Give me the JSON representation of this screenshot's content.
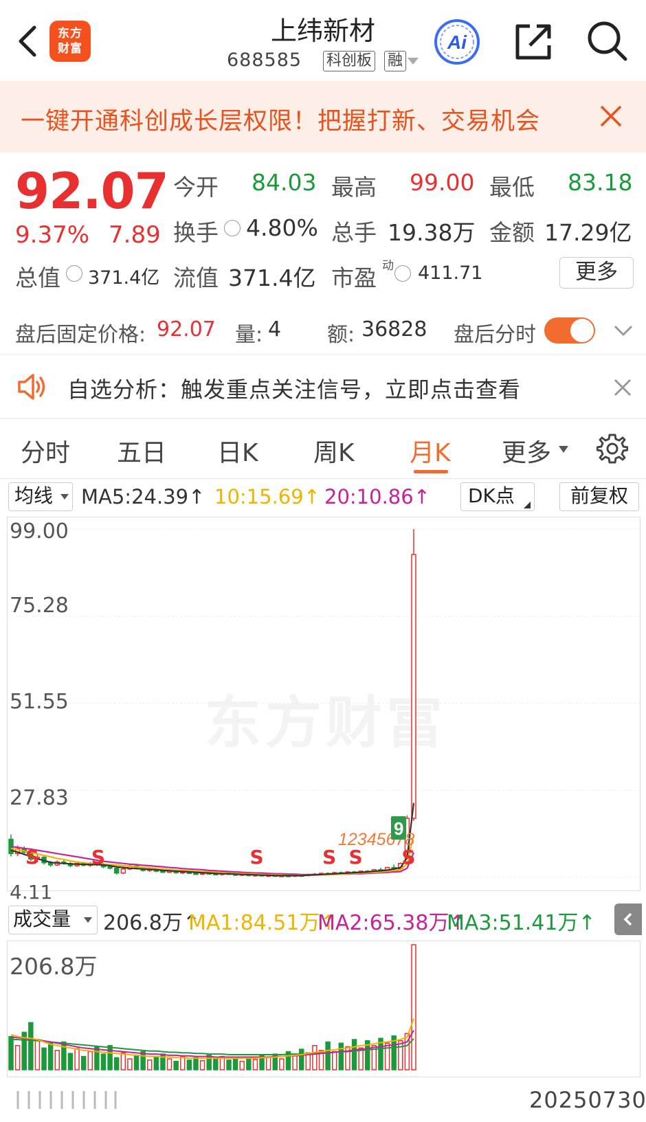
{
  "header": {
    "logo": [
      "东方",
      "财富"
    ],
    "title": "上纬新材",
    "code": "688585",
    "tags": [
      "科创板",
      "融"
    ],
    "ai_label": "Ai"
  },
  "banner": {
    "text": "一键开通科创成长层权限！把握打新、交易机会"
  },
  "quote": {
    "price": "92.07",
    "change_pct": "9.37%",
    "change": "7.89",
    "open_label": "今开",
    "open": "84.03",
    "high_label": "最高",
    "high": "99.00",
    "low_label": "最低",
    "low": "83.18",
    "turnover_label": "换手",
    "turnover": "4.80%",
    "volume_label": "总手",
    "volume": "19.38万",
    "amount_label": "金额",
    "amount": "17.29亿",
    "mktcap_label": "总值",
    "mktcap": "371.4亿",
    "float_label": "流值",
    "float": "371.4亿",
    "pe_label": "市盈",
    "pe_sup": "动",
    "pe": "411.71",
    "more_label": "更多"
  },
  "after_hours": {
    "price_label": "盘后固定价格:",
    "price": "92.07",
    "qty_label": "量:",
    "qty": "4",
    "amt_label": "额:",
    "amt": "36828",
    "toggle_label": "盘后分时"
  },
  "notice": {
    "text": "自选分析：触发重点关注信号，立即点击查看"
  },
  "tabs": [
    {
      "label": "分时"
    },
    {
      "label": "五日"
    },
    {
      "label": "日K"
    },
    {
      "label": "周K"
    },
    {
      "label": "月K"
    },
    {
      "label": "更多"
    }
  ],
  "ma_row": {
    "type_label": "均线",
    "ma5": "MA5:24.39↑",
    "ma10": "10:15.69↑",
    "ma20": "20:10.86↑",
    "dk_label": "DK点",
    "adjust_label": "前复权"
  },
  "price_axis": [
    "99.00",
    "75.28",
    "51.55",
    "27.83",
    "4.11"
  ],
  "watermark": "东方财富",
  "signals": {
    "sell": "S",
    "count_seq": "12345678",
    "count_last": "9"
  },
  "volume": {
    "type_label": "成交量",
    "current": "206.8万↑",
    "ma1": "MA1:84.51万↑",
    "ma2": "MA2:65.38万↑",
    "ma3": "MA3:51.41万↑",
    "axis_top": "206.8万"
  },
  "date": "20250730",
  "colors": {
    "up": "#e93030",
    "down": "#1a9a3a",
    "accent": "#f26c2f",
    "ma5": "#333333",
    "ma10": "#f0b400",
    "ma20": "#c8219a"
  },
  "chart_data": {
    "type": "candlestick",
    "ylim": [
      4.11,
      99.0
    ],
    "candles": [
      {
        "o": 14.5,
        "h": 15.8,
        "l": 9.8,
        "c": 10.6
      },
      {
        "o": 10.6,
        "h": 12.8,
        "l": 9.9,
        "c": 11.9
      },
      {
        "o": 11.9,
        "h": 12.6,
        "l": 10.4,
        "c": 11.0
      },
      {
        "o": 11.0,
        "h": 11.6,
        "l": 8.6,
        "c": 9.1
      },
      {
        "o": 9.1,
        "h": 10.4,
        "l": 8.2,
        "c": 9.6
      },
      {
        "o": 9.6,
        "h": 9.9,
        "l": 7.6,
        "c": 8.1
      },
      {
        "o": 8.1,
        "h": 8.6,
        "l": 7.0,
        "c": 7.5
      },
      {
        "o": 7.5,
        "h": 8.7,
        "l": 7.2,
        "c": 8.3
      },
      {
        "o": 8.3,
        "h": 8.9,
        "l": 7.6,
        "c": 7.9
      },
      {
        "o": 7.9,
        "h": 8.3,
        "l": 6.9,
        "c": 7.3
      },
      {
        "o": 7.3,
        "h": 8.2,
        "l": 7.0,
        "c": 7.9
      },
      {
        "o": 7.9,
        "h": 8.4,
        "l": 7.1,
        "c": 7.4
      },
      {
        "o": 7.4,
        "h": 8.3,
        "l": 7.0,
        "c": 8.0
      },
      {
        "o": 8.0,
        "h": 8.5,
        "l": 7.2,
        "c": 7.6
      },
      {
        "o": 7.6,
        "h": 8.0,
        "l": 6.6,
        "c": 7.0
      },
      {
        "o": 7.0,
        "h": 7.6,
        "l": 6.3,
        "c": 6.6
      },
      {
        "o": 6.6,
        "h": 7.0,
        "l": 4.9,
        "c": 5.3
      },
      {
        "o": 5.3,
        "h": 6.8,
        "l": 5.0,
        "c": 6.4
      },
      {
        "o": 6.4,
        "h": 7.6,
        "l": 6.1,
        "c": 7.2
      },
      {
        "o": 7.2,
        "h": 7.5,
        "l": 6.3,
        "c": 6.6
      },
      {
        "o": 6.6,
        "h": 6.9,
        "l": 5.7,
        "c": 6.0
      },
      {
        "o": 6.0,
        "h": 6.8,
        "l": 5.6,
        "c": 6.4
      },
      {
        "o": 6.4,
        "h": 6.7,
        "l": 5.5,
        "c": 5.8
      },
      {
        "o": 5.8,
        "h": 6.3,
        "l": 5.3,
        "c": 5.5
      },
      {
        "o": 5.5,
        "h": 6.2,
        "l": 5.3,
        "c": 5.9
      },
      {
        "o": 5.9,
        "h": 6.2,
        "l": 5.1,
        "c": 5.4
      },
      {
        "o": 5.4,
        "h": 5.9,
        "l": 5.0,
        "c": 5.6
      },
      {
        "o": 5.6,
        "h": 5.9,
        "l": 5.0,
        "c": 5.2
      },
      {
        "o": 5.2,
        "h": 5.6,
        "l": 4.8,
        "c": 5.0
      },
      {
        "o": 5.0,
        "h": 5.5,
        "l": 4.7,
        "c": 5.3
      },
      {
        "o": 5.3,
        "h": 5.6,
        "l": 4.9,
        "c": 5.1
      },
      {
        "o": 5.1,
        "h": 5.4,
        "l": 4.7,
        "c": 4.9
      },
      {
        "o": 4.9,
        "h": 5.4,
        "l": 4.6,
        "c": 5.2
      },
      {
        "o": 5.2,
        "h": 5.5,
        "l": 4.8,
        "c": 5.0
      },
      {
        "o": 5.0,
        "h": 5.4,
        "l": 4.5,
        "c": 4.7
      },
      {
        "o": 4.7,
        "h": 5.2,
        "l": 4.5,
        "c": 5.0
      },
      {
        "o": 5.0,
        "h": 5.2,
        "l": 4.4,
        "c": 4.6
      },
      {
        "o": 4.6,
        "h": 5.0,
        "l": 4.3,
        "c": 4.8
      },
      {
        "o": 4.8,
        "h": 5.1,
        "l": 4.4,
        "c": 4.5
      },
      {
        "o": 4.5,
        "h": 4.9,
        "l": 4.2,
        "c": 4.7
      },
      {
        "o": 4.7,
        "h": 4.9,
        "l": 4.3,
        "c": 4.4
      },
      {
        "o": 4.4,
        "h": 4.8,
        "l": 4.2,
        "c": 4.6
      },
      {
        "o": 4.6,
        "h": 4.9,
        "l": 4.3,
        "c": 4.5
      },
      {
        "o": 4.5,
        "h": 4.8,
        "l": 4.2,
        "c": 4.7
      },
      {
        "o": 4.7,
        "h": 5.0,
        "l": 4.4,
        "c": 4.6
      },
      {
        "o": 4.6,
        "h": 5.1,
        "l": 4.4,
        "c": 4.9
      },
      {
        "o": 4.9,
        "h": 5.3,
        "l": 4.6,
        "c": 5.0
      },
      {
        "o": 5.0,
        "h": 5.4,
        "l": 4.7,
        "c": 5.2
      },
      {
        "o": 5.2,
        "h": 5.5,
        "l": 4.8,
        "c": 4.9
      },
      {
        "o": 4.9,
        "h": 5.6,
        "l": 4.8,
        "c": 5.4
      },
      {
        "o": 5.4,
        "h": 5.7,
        "l": 5.0,
        "c": 5.1
      },
      {
        "o": 5.1,
        "h": 5.8,
        "l": 5.0,
        "c": 5.6
      },
      {
        "o": 5.6,
        "h": 5.9,
        "l": 5.1,
        "c": 5.3
      },
      {
        "o": 5.3,
        "h": 6.0,
        "l": 5.2,
        "c": 5.8
      },
      {
        "o": 5.8,
        "h": 6.1,
        "l": 5.3,
        "c": 5.5
      },
      {
        "o": 5.5,
        "h": 6.4,
        "l": 5.4,
        "c": 6.2
      },
      {
        "o": 6.2,
        "h": 6.7,
        "l": 5.8,
        "c": 6.0
      },
      {
        "o": 6.0,
        "h": 7.0,
        "l": 5.9,
        "c": 6.8
      },
      {
        "o": 6.8,
        "h": 7.6,
        "l": 6.3,
        "c": 6.5
      },
      {
        "o": 6.5,
        "h": 8.2,
        "l": 6.3,
        "c": 7.9
      },
      {
        "o": 7.9,
        "h": 21.0,
        "l": 7.6,
        "c": 20.2
      },
      {
        "o": 20.2,
        "h": 99.0,
        "l": 19.5,
        "c": 92.07
      }
    ],
    "ma5": [
      11.5,
      11.0,
      10.4,
      9.8,
      9.2,
      8.7,
      8.2,
      8.0,
      7.9,
      7.8,
      7.7,
      7.7,
      7.6,
      7.6,
      7.5,
      7.3,
      7.0,
      6.8,
      6.6,
      6.5,
      6.4,
      6.3,
      6.2,
      6.0,
      5.9,
      5.8,
      5.7,
      5.6,
      5.5,
      5.4,
      5.3,
      5.2,
      5.1,
      5.1,
      5.0,
      4.9,
      4.9,
      4.8,
      4.7,
      4.7,
      4.6,
      4.6,
      4.6,
      4.6,
      4.6,
      4.7,
      4.8,
      4.9,
      5.0,
      5.1,
      5.2,
      5.3,
      5.4,
      5.5,
      5.6,
      5.8,
      5.9,
      6.1,
      6.4,
      6.8,
      9.5,
      24.39
    ],
    "ma10": [
      12.0,
      11.7,
      11.3,
      10.9,
      10.5,
      10.1,
      9.7,
      9.3,
      9.0,
      8.6,
      8.3,
      8.1,
      7.9,
      7.8,
      7.7,
      7.6,
      7.5,
      7.3,
      7.1,
      7.0,
      6.8,
      6.7,
      6.5,
      6.4,
      6.2,
      6.1,
      6.0,
      5.9,
      5.8,
      5.7,
      5.6,
      5.5,
      5.4,
      5.3,
      5.2,
      5.1,
      5.1,
      5.0,
      4.9,
      4.9,
      4.8,
      4.8,
      4.7,
      4.7,
      4.7,
      4.7,
      4.7,
      4.8,
      4.8,
      4.9,
      5.0,
      5.1,
      5.2,
      5.3,
      5.4,
      5.5,
      5.6,
      5.8,
      6.0,
      6.2,
      7.8,
      15.69
    ],
    "ma20": [
      12.5,
      12.3,
      12.0,
      11.8,
      11.5,
      11.2,
      10.9,
      10.6,
      10.3,
      10.0,
      9.7,
      9.4,
      9.1,
      8.8,
      8.5,
      8.3,
      8.1,
      7.9,
      7.7,
      7.6,
      7.4,
      7.3,
      7.1,
      7.0,
      6.8,
      6.7,
      6.5,
      6.4,
      6.3,
      6.2,
      6.0,
      5.9,
      5.8,
      5.7,
      5.6,
      5.5,
      5.4,
      5.3,
      5.3,
      5.2,
      5.1,
      5.1,
      5.0,
      5.0,
      4.9,
      4.9,
      4.9,
      4.9,
      4.9,
      4.9,
      5.0,
      5.0,
      5.1,
      5.1,
      5.2,
      5.3,
      5.4,
      5.5,
      5.6,
      5.7,
      6.6,
      10.86
    ],
    "sell_signal_indices": [
      3,
      13,
      37,
      48,
      52,
      60
    ],
    "volume_ylim": [
      0,
      206.8
    ],
    "volume_values": [
      55,
      40,
      62,
      78,
      50,
      36,
      44,
      32,
      46,
      27,
      35,
      22,
      30,
      38,
      26,
      40,
      20,
      28,
      18,
      24,
      30,
      16,
      22,
      26,
      18,
      14,
      22,
      16,
      20,
      15,
      24,
      18,
      22,
      16,
      21,
      14,
      19,
      17,
      24,
      20,
      26,
      18,
      30,
      24,
      34,
      28,
      40,
      32,
      46,
      30,
      44,
      38,
      50,
      36,
      48,
      40,
      52,
      44,
      56,
      48,
      60,
      206.8
    ],
    "volume_ma1": [
      58,
      55,
      53,
      52,
      50,
      46,
      42,
      40,
      38,
      36,
      34,
      32,
      31,
      30,
      29,
      28,
      27,
      26,
      25,
      24,
      23,
      22,
      22,
      21,
      21,
      20,
      20,
      19,
      19,
      19,
      19,
      19,
      19,
      19,
      19,
      19,
      19,
      19,
      20,
      20,
      21,
      22,
      23,
      24,
      25,
      27,
      29,
      30,
      32,
      33,
      35,
      36,
      38,
      40,
      41,
      43,
      45,
      46,
      48,
      50,
      54,
      84.51
    ],
    "volume_ma2": [
      54,
      53,
      52,
      51,
      50,
      48,
      46,
      44,
      42,
      40,
      38,
      36,
      35,
      34,
      33,
      32,
      31,
      30,
      29,
      28,
      27,
      26,
      26,
      25,
      24,
      24,
      23,
      23,
      22,
      22,
      22,
      21,
      21,
      21,
      21,
      21,
      21,
      21,
      21,
      21,
      22,
      22,
      23,
      23,
      24,
      25,
      26,
      27,
      28,
      29,
      30,
      31,
      33,
      34,
      35,
      37,
      38,
      40,
      41,
      43,
      46,
      65.38
    ],
    "volume_ma3": [
      50,
      50,
      49,
      49,
      48,
      47,
      46,
      45,
      44,
      43,
      42,
      41,
      40,
      39,
      38,
      37,
      36,
      35,
      34,
      33,
      32,
      31,
      31,
      30,
      29,
      29,
      28,
      28,
      27,
      27,
      26,
      26,
      26,
      25,
      25,
      25,
      25,
      25,
      25,
      25,
      25,
      25,
      26,
      26,
      26,
      27,
      27,
      28,
      28,
      29,
      30,
      30,
      31,
      32,
      33,
      34,
      35,
      36,
      37,
      38,
      40,
      51.41
    ]
  }
}
